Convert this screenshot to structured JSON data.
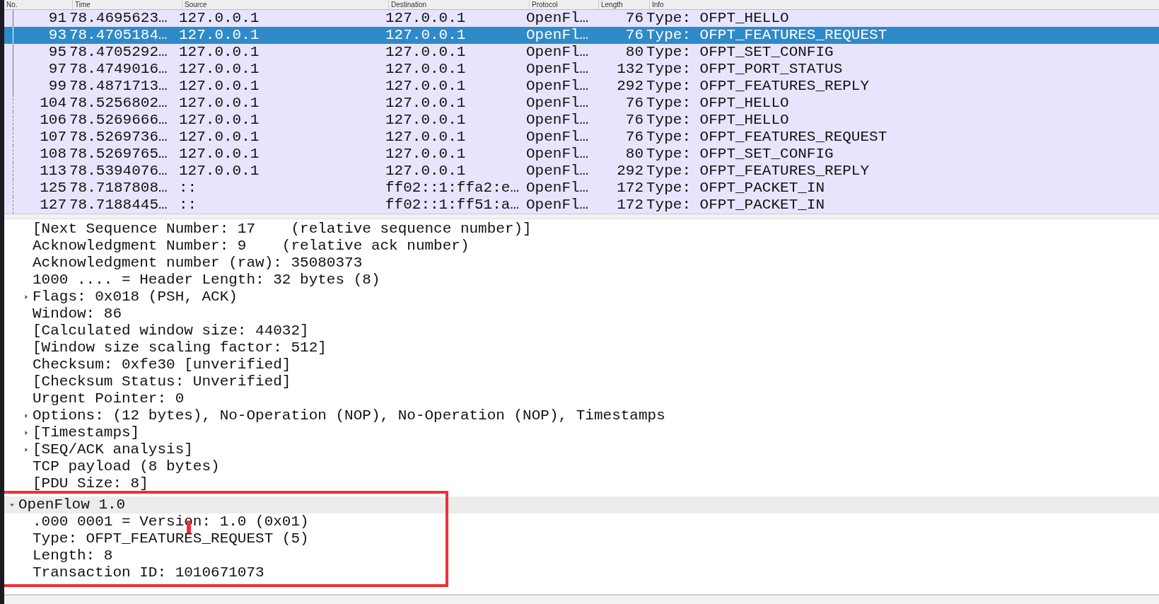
{
  "packet_list": {
    "columns": [
      "No.",
      "Time",
      "Source",
      "Destination",
      "Protocol",
      "Length",
      "Info"
    ],
    "rows": [
      {
        "no": "91",
        "time": "78.4695623…",
        "source": "127.0.0.1",
        "destination": "127.0.0.1",
        "protocol": "OpenFl…",
        "length": "76",
        "info": "Type: OFPT_HELLO",
        "selected": false,
        "kind": "solid"
      },
      {
        "no": "93",
        "time": "78.4705184…",
        "source": "127.0.0.1",
        "destination": "127.0.0.1",
        "protocol": "OpenFl…",
        "length": "76",
        "info": "Type: OFPT_FEATURES_REQUEST",
        "selected": true,
        "kind": "solid"
      },
      {
        "no": "95",
        "time": "78.4705292…",
        "source": "127.0.0.1",
        "destination": "127.0.0.1",
        "protocol": "OpenFl…",
        "length": "80",
        "info": "Type: OFPT_SET_CONFIG",
        "selected": false,
        "kind": "solid"
      },
      {
        "no": "97",
        "time": "78.4749016…",
        "source": "127.0.0.1",
        "destination": "127.0.0.1",
        "protocol": "OpenFl…",
        "length": "132",
        "info": "Type: OFPT_PORT_STATUS",
        "selected": false,
        "kind": "solid"
      },
      {
        "no": "99",
        "time": "78.4871713…",
        "source": "127.0.0.1",
        "destination": "127.0.0.1",
        "protocol": "OpenFl…",
        "length": "292",
        "info": "Type: OFPT_FEATURES_REPLY",
        "selected": false,
        "kind": "solid"
      },
      {
        "no": "104",
        "time": "78.5256802…",
        "source": "127.0.0.1",
        "destination": "127.0.0.1",
        "protocol": "OpenFl…",
        "length": "76",
        "info": "Type: OFPT_HELLO",
        "selected": false,
        "kind": "dashed"
      },
      {
        "no": "106",
        "time": "78.5269666…",
        "source": "127.0.0.1",
        "destination": "127.0.0.1",
        "protocol": "OpenFl…",
        "length": "76",
        "info": "Type: OFPT_HELLO",
        "selected": false,
        "kind": "dashed"
      },
      {
        "no": "107",
        "time": "78.5269736…",
        "source": "127.0.0.1",
        "destination": "127.0.0.1",
        "protocol": "OpenFl…",
        "length": "76",
        "info": "Type: OFPT_FEATURES_REQUEST",
        "selected": false,
        "kind": "dashed"
      },
      {
        "no": "108",
        "time": "78.5269765…",
        "source": "127.0.0.1",
        "destination": "127.0.0.1",
        "protocol": "OpenFl…",
        "length": "80",
        "info": "Type: OFPT_SET_CONFIG",
        "selected": false,
        "kind": "dashed"
      },
      {
        "no": "113",
        "time": "78.5394076…",
        "source": "127.0.0.1",
        "destination": "127.0.0.1",
        "protocol": "OpenFl…",
        "length": "292",
        "info": "Type: OFPT_FEATURES_REPLY",
        "selected": false,
        "kind": "dashed"
      },
      {
        "no": "125",
        "time": "78.7187808…",
        "source": "::",
        "destination": "ff02::1:ffa2:e…",
        "protocol": "OpenFl…",
        "length": "172",
        "info": "Type: OFPT_PACKET_IN",
        "selected": false,
        "kind": "dashed"
      },
      {
        "no": "127",
        "time": "78.7188445…",
        "source": "::",
        "destination": "ff02::1:ff51:a…",
        "protocol": "OpenFl…",
        "length": "172",
        "info": "Type: OFPT_PACKET_IN",
        "selected": false,
        "kind": "dashed"
      }
    ]
  },
  "details": {
    "tcp_fields": [
      {
        "text": "[Next Sequence Number: 17    (relative sequence number)]",
        "selected": false
      },
      {
        "text": "Acknowledgment Number: 9    (relative ack number)",
        "selected": false
      },
      {
        "text": "Acknowledgment number (raw): 35080373",
        "selected": false
      },
      {
        "text": "1000 .... = Header Length: 32 bytes (8)",
        "selected": false
      },
      {
        "text": "Flags: 0x018 (PSH, ACK)",
        "selected": false,
        "expanded": false
      },
      {
        "text": "Window: 86",
        "selected": false
      },
      {
        "text": "[Calculated window size: 44032]",
        "selected": false
      },
      {
        "text": "[Window size scaling factor: 512]",
        "selected": false
      },
      {
        "text": "Checksum: 0xfe30 [unverified]",
        "selected": false
      },
      {
        "text": "[Checksum Status: Unverified]",
        "selected": false
      },
      {
        "text": "Urgent Pointer: 0",
        "selected": false
      },
      {
        "text": "Options: (12 bytes), No-Operation (NOP), No-Operation (NOP), Timestamps",
        "selected": false,
        "expanded": false
      },
      {
        "text": "[Timestamps]",
        "selected": false,
        "expanded": false
      },
      {
        "text": "[SEQ/ACK analysis]",
        "selected": false,
        "expanded": false
      },
      {
        "text": "TCP payload (8 bytes)",
        "selected": false
      },
      {
        "text": "[PDU Size: 8]",
        "selected": false
      }
    ],
    "openflow": {
      "text": "OpenFlow 1.0",
      "selected": true,
      "expanded": true,
      "children": [
        {
          "text": ".000 0001 = Version: 1.0 (0x01)",
          "selected": false
        },
        {
          "text": "Type: OFPT_FEATURES_REQUEST (5)",
          "selected": false
        },
        {
          "text": "Length: 8",
          "selected": false
        },
        {
          "text": "Transaction ID: 1010671073",
          "selected": false
        }
      ]
    }
  }
}
